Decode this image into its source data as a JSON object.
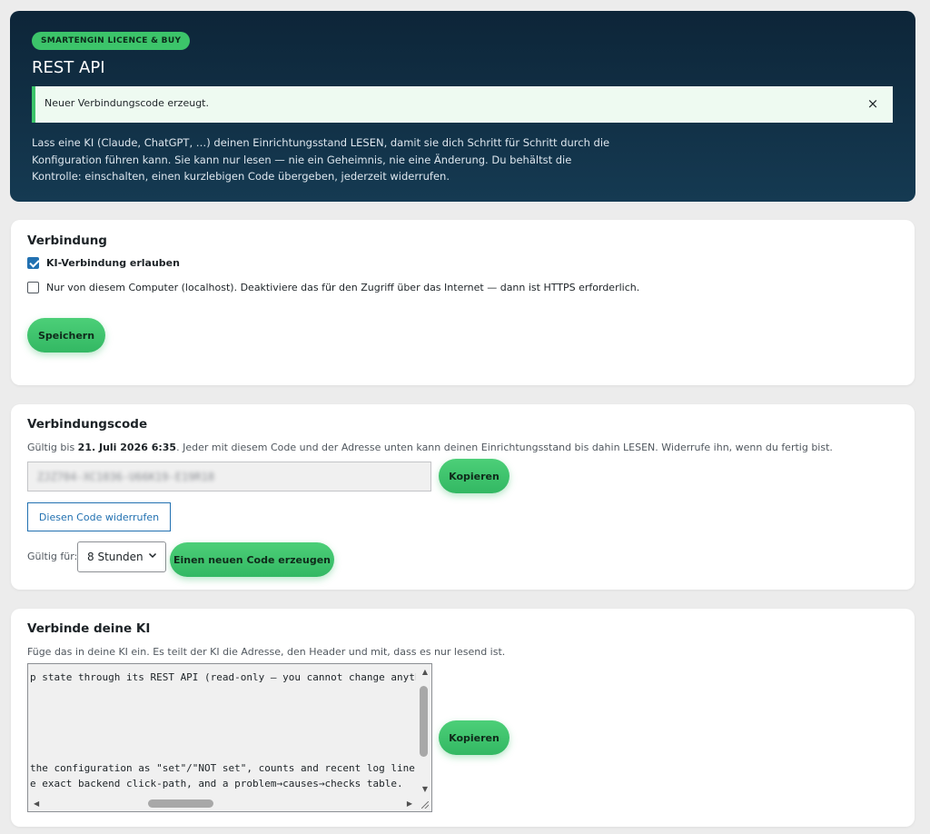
{
  "header": {
    "badge": "SMARTENGIN LICENCE & BUY",
    "title": "REST API",
    "notice": "Neuer Verbindungscode erzeugt.",
    "notice_close": "×",
    "intro": "Lass eine KI (Claude, ChatGPT, …) deinen Einrichtungsstand LESEN, damit sie dich Schritt für Schritt durch die Konfiguration führen kann. Sie kann nur lesen — nie ein Geheimnis, nie eine Änderung. Du behältst die Kontrolle: einschalten, einen kurzlebigen Code übergeben, jederzeit widerrufen."
  },
  "connection": {
    "title": "Verbindung",
    "allow_label": "KI-Verbindung erlauben",
    "allow_checked": true,
    "localhost_label": "Nur von diesem Computer (localhost). Deaktiviere das für den Zugriff über das Internet — dann ist HTTPS erforderlich.",
    "localhost_checked": false,
    "save_label": "Speichern"
  },
  "code": {
    "title": "Verbindungscode",
    "valid_prefix": "Gültig bis ",
    "valid_until": "21. Juli 2026 6:35",
    "valid_suffix": ". Jeder mit diesem Code und der Adresse unten kann deinen Einrichtungsstand bis dahin LESEN. Widerrufe ihn, wenn du fertig bist.",
    "code_value": "ZJZ704-XC1036-U66K19-E19R18",
    "copy_label": "Kopieren",
    "revoke_label": "Diesen Code widerrufen",
    "valid_for_label": "Gültig für:",
    "duration_selected": "8 Stunden",
    "generate_label": "Einen neuen Code erzeugen"
  },
  "connect": {
    "title": "Verbinde deine KI",
    "desc": "Füge das in deine KI ein. Es teilt der KI die Adresse, den Header und mit, dass es nur lesend ist.",
    "lines": [
      "p state through its REST API (read-only — you cannot change anythi",
      "the configuration as \"set\"/\"NOT set\", counts and recent log lines.",
      "e exact backend click-path, and a problem→causes→checks table."
    ],
    "copy_label": "Kopieren"
  },
  "icons": {
    "checkbox_checked": "checkmark-icon",
    "close": "close-icon",
    "chevron": "chevron-down-icon"
  },
  "colors": {
    "accent_green": "#3cc46a",
    "header_bg": "#0d2538",
    "link_blue": "#2271b1"
  }
}
